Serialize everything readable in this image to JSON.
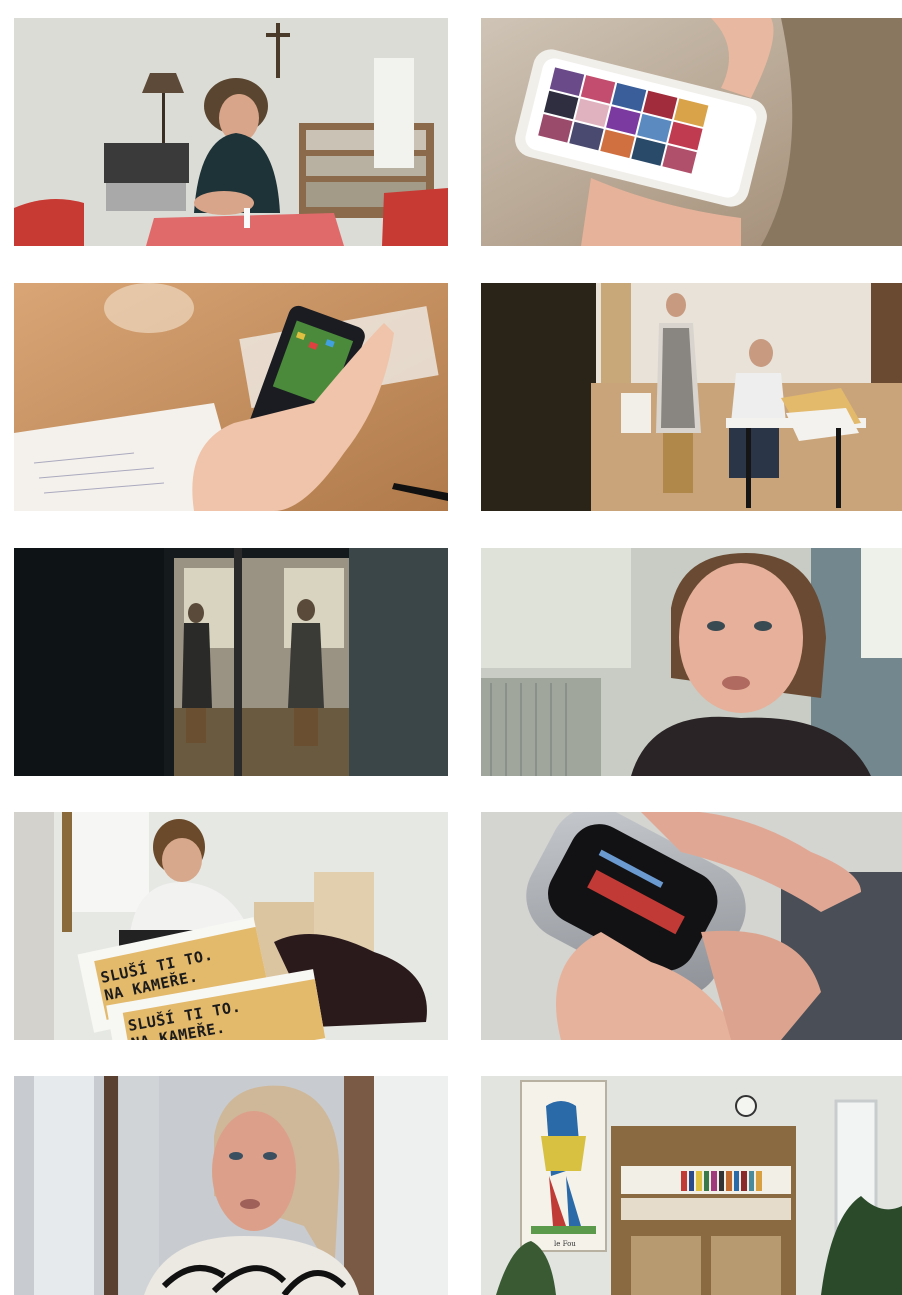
{
  "gallery": {
    "frames": [
      {
        "id": "f1",
        "subject": "man-at-red-table"
      },
      {
        "id": "f2",
        "subject": "smartphone-photo-grid"
      },
      {
        "id": "f3",
        "subject": "feature-phone-game"
      },
      {
        "id": "f4",
        "subject": "woman-and-man-with-laptop"
      },
      {
        "id": "f5",
        "subject": "hallway-figures"
      },
      {
        "id": "f6",
        "subject": "woman-portrait"
      },
      {
        "id": "f7",
        "subject": "man-with-posters"
      },
      {
        "id": "f8",
        "subject": "silver-phone-closeup"
      },
      {
        "id": "f9",
        "subject": "blonde-woman-portrait"
      },
      {
        "id": "f10",
        "subject": "room-with-tarot-poster"
      }
    ],
    "posters": {
      "line1": "SLUŠÍ TI TO.",
      "line2": "NA KAMEŘE."
    },
    "tarot_caption": "le Fou"
  },
  "colors": {
    "table_red": "#e06a6a",
    "chair_red": "#c73a33",
    "poster_ochre": "#e3b96c",
    "wall_grey": "#dcdcd8",
    "skin": "#e8b8a0"
  }
}
